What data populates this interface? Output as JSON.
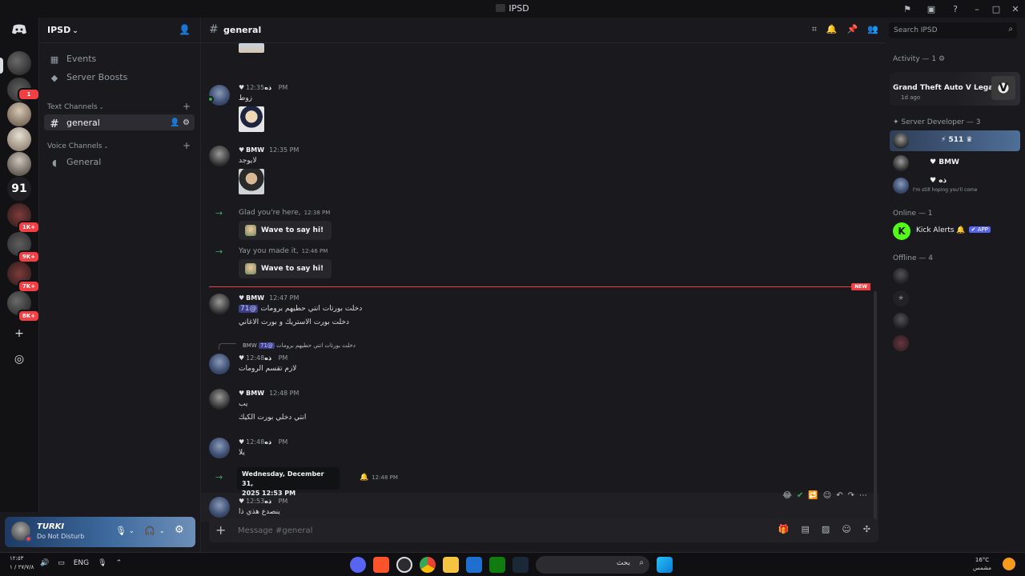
{
  "window": {
    "title": "IPSD"
  },
  "server": {
    "name": "IPSD"
  },
  "sidebar": {
    "top_items": [
      {
        "label": "Events",
        "icon": "calendar-icon"
      },
      {
        "label": "Server Boosts",
        "icon": "boost-icon"
      }
    ],
    "text_category": "Text Channels",
    "voice_category": "Voice Channels",
    "text_channels": [
      {
        "label": "general"
      }
    ],
    "voice_channels": [
      {
        "label": "General"
      }
    ]
  },
  "rail": {
    "badges": [
      "1",
      "1K+",
      "9K+",
      "7K+",
      "8K+"
    ],
    "text_server": "91"
  },
  "user_panel": {
    "name": "TURKI",
    "status": "Do Not Disturb"
  },
  "channel": {
    "name": "general"
  },
  "messages": [
    {
      "author": "ذه",
      "time": "12:35 PM",
      "text": "زوط",
      "attachment": true
    },
    {
      "author": "BMW",
      "time": "12:35 PM",
      "text": "لايوجد",
      "attachment": true
    },
    {
      "system": true,
      "text": "Glad you're here,",
      "time": "12:38 PM",
      "button": "Wave to say hi!"
    },
    {
      "system": true,
      "text": "Yay you made it,",
      "time": "12:46 PM",
      "button": "Wave to say hi!"
    },
    {
      "author": "BMW",
      "time": "12:47 PM",
      "lines": [
        "دخلت بورتات انتي حطيهم برومات",
        "دخلت بورت الاستريك و بورت الاغاني"
      ],
      "mention": "@71"
    },
    {
      "author": "ذه",
      "time": "12:48 PM",
      "reply_author": "BMW",
      "reply_text": "دخلت بورتات انتي حطيهم برومات",
      "reply_mention": "@71",
      "text": "لازم تقسم الرومات"
    },
    {
      "author": "BMW",
      "time": "12:48 PM",
      "lines": [
        "يب",
        "انتي دخلي بورت الكيك"
      ]
    },
    {
      "author": "ذه",
      "time": "12:48 PM",
      "text": "يلا"
    },
    {
      "system": true,
      "time": "12:48 PM"
    },
    {
      "author": "ذه",
      "time": "12:53 PM",
      "text": "ينصدع هذي ذا"
    }
  ],
  "new_label": "NEW",
  "tooltip": {
    "line1": "Wednesday, December 31,",
    "line2": "2025 12:53 PM"
  },
  "composer": {
    "placeholder": "Message #general"
  },
  "members": {
    "search_placeholder": "Search IPSD",
    "activity_header": "Activity — 1",
    "activity": {
      "game": "Grand Theft Auto V Legacy",
      "ago": "1d ago"
    },
    "role_header": "Server Developer — 3",
    "dev_members": [
      {
        "name": "",
        "tag": "511"
      },
      {
        "name": "BMW"
      },
      {
        "name": "ذه",
        "sub": "I'm still hoping you'll come"
      }
    ],
    "online_header": "Online — 1",
    "online_members": [
      {
        "name": "Kick Alerts",
        "tag": "APP"
      }
    ],
    "offline_header": "Offline — 4"
  },
  "taskbar": {
    "time": "١٢:٥٣",
    "date": "٢٧/٧/٨ / ١",
    "lang": "ENG",
    "search": "بحث",
    "weather_temp": "16°C",
    "weather_desc": "مشمس"
  }
}
